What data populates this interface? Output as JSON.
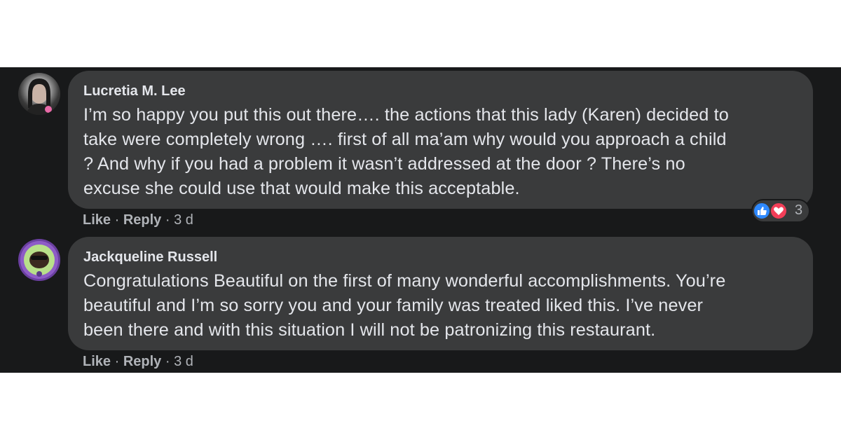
{
  "comments": [
    {
      "author": "Lucretia M. Lee",
      "lines": [
        "I’m so happy you put this out there…. the actions that this lady (Karen) decided to",
        "take were completely wrong …. first of all ma’am why would you approach a child",
        "? And why if you had a problem it wasn’t addressed at the door ? There’s no",
        "excuse she could use that would make this acceptable."
      ],
      "like_label": "Like",
      "reply_label": "Reply",
      "sep": " · ",
      "time": "3 d",
      "reactions": {
        "count": "3",
        "icons": [
          "like-icon",
          "love-icon"
        ]
      }
    },
    {
      "author": "Jackqueline Russell",
      "lines": [
        "Congratulations Beautiful on the first of many wonderful accomplishments. You’re",
        "beautiful and I’m so sorry you and your family was treated liked this. I’ve never",
        "been there and with this situation I will not be patronizing this restaurant."
      ],
      "like_label": "Like",
      "reply_label": "Reply",
      "sep": " · ",
      "time": "3 d"
    }
  ],
  "colors": {
    "background": "#18191a",
    "bubble": "#3a3b3c",
    "text": "#e4e6eb",
    "secondary_text": "#b0b3b8",
    "like_blue": "#2e89ff",
    "love_red": "#f33e58"
  }
}
